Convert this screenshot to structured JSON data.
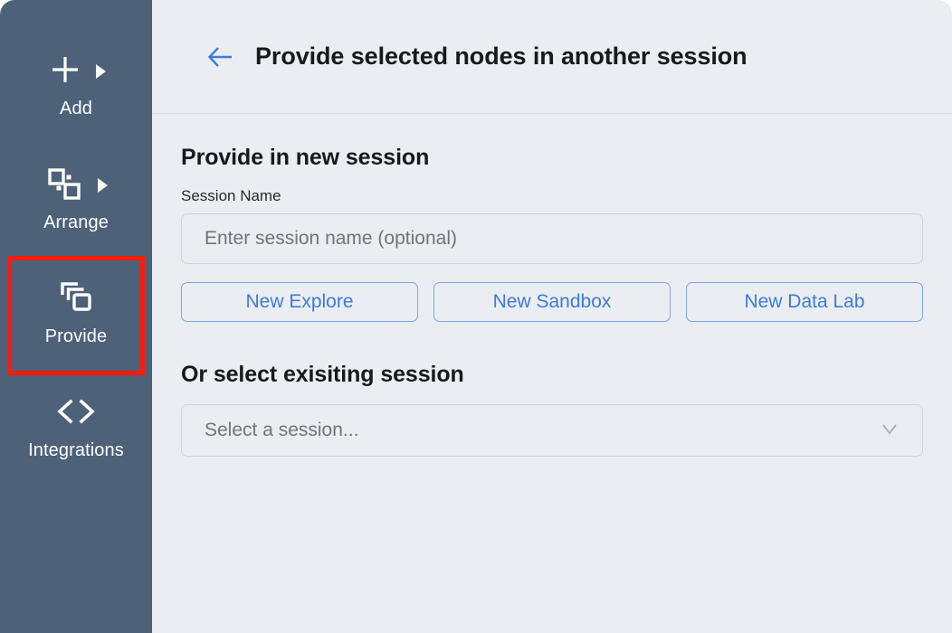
{
  "sidebar": {
    "items": [
      {
        "label": "Add",
        "icon": "plus-icon",
        "has_caret": true,
        "highlighted": false
      },
      {
        "label": "Arrange",
        "icon": "arrange-icon",
        "has_caret": true,
        "highlighted": false
      },
      {
        "label": "Provide",
        "icon": "copy-layers-icon",
        "has_caret": false,
        "highlighted": true
      },
      {
        "label": "Integrations",
        "icon": "code-brackets-icon",
        "has_caret": false,
        "highlighted": false
      }
    ]
  },
  "header": {
    "back_icon": "arrow-left-icon",
    "title": "Provide selected nodes in another session"
  },
  "main": {
    "new_session": {
      "heading": "Provide in new session",
      "session_name_label": "Session Name",
      "session_name_value": "",
      "session_name_placeholder": "Enter session name (optional)",
      "buttons": [
        {
          "label": "New Explore"
        },
        {
          "label": "New Sandbox"
        },
        {
          "label": "New Data Lab"
        }
      ]
    },
    "existing_session": {
      "heading": "Or select exisiting session",
      "select_value": "Select a session...",
      "select_icon": "chevron-down-icon"
    }
  },
  "colors": {
    "sidebar_bg": "#4d6279",
    "page_bg": "#eaeef2",
    "accent_blue": "#3f7ad6",
    "highlight_red": "#ff1a0a",
    "text_dark": "#171a1d",
    "text_muted": "#6c757d",
    "border_gray": "#ccd3da"
  }
}
